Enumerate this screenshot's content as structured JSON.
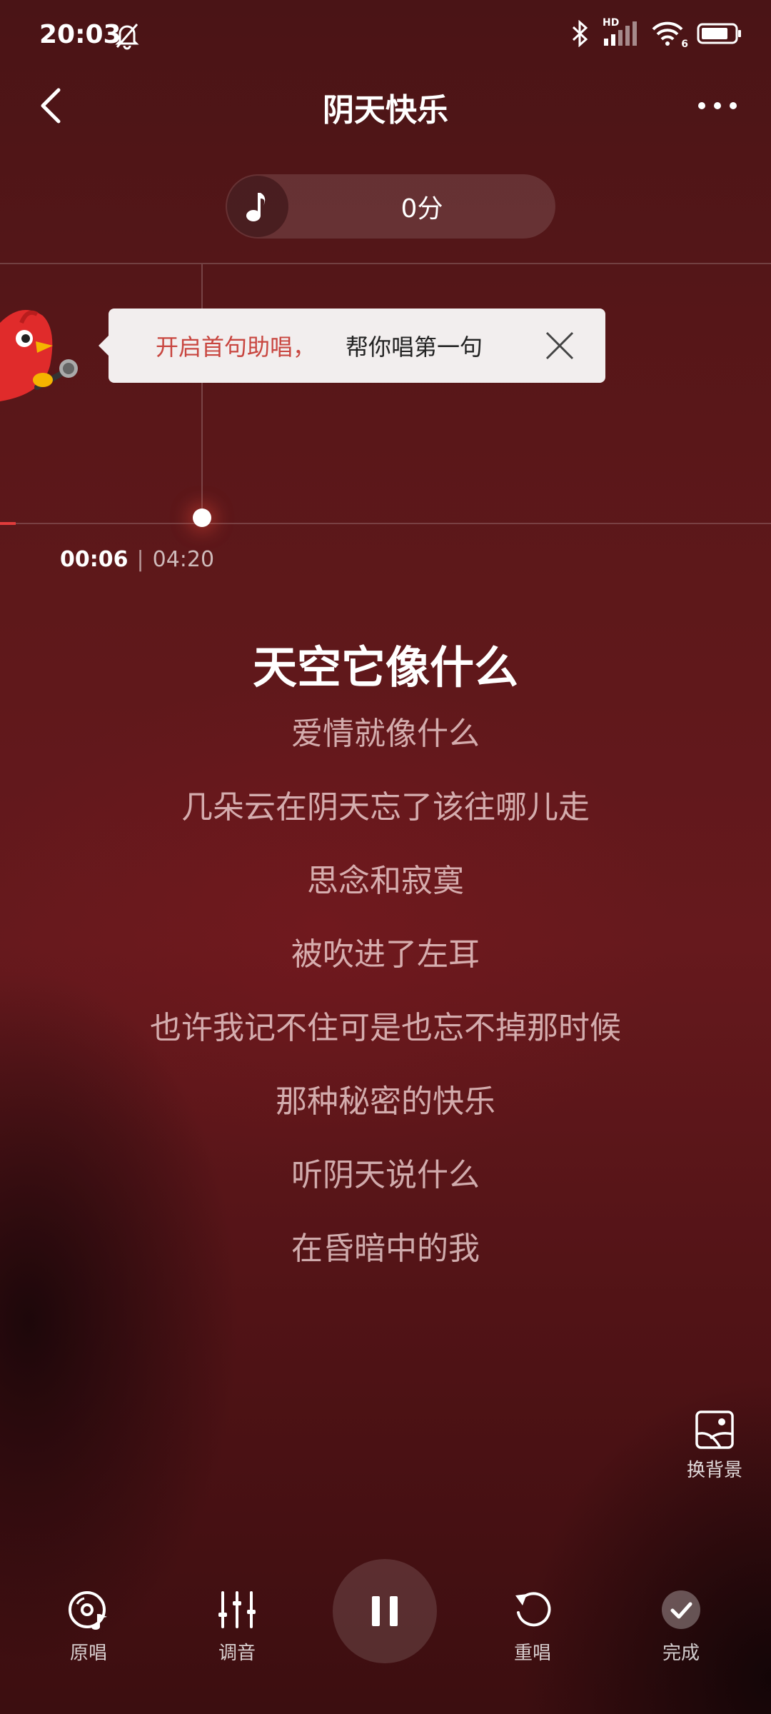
{
  "status_bar": {
    "time": "20:03",
    "network_label": "HD",
    "wifi_label": "6"
  },
  "header": {
    "title": "阴天快乐"
  },
  "score": {
    "text": "0分"
  },
  "tooltip": {
    "highlight_text": "开启首句助唱，",
    "text": "帮你唱第一句"
  },
  "playback": {
    "current_time": "00:06",
    "separator": "|",
    "total_time": "04:20",
    "progress": 0.023
  },
  "lyrics": {
    "current": "天空它像什么",
    "upcoming": [
      "爱情就像什么",
      "几朵云在阴天忘了该往哪儿走",
      "思念和寂寞",
      "被吹进了左耳",
      "也许我记不住可是也忘不掉那时候",
      "那种秘密的快乐",
      "听阴天说什么",
      "在昏暗中的我"
    ]
  },
  "background_button": {
    "label": "换背景",
    "icon": "change-background-icon"
  },
  "controls": {
    "original": {
      "label": "原唱",
      "icon": "original-vocal-icon"
    },
    "tune": {
      "label": "调音",
      "icon": "equalizer-icon"
    },
    "play": {
      "icon": "pause-icon"
    },
    "restart": {
      "label": "重唱",
      "icon": "restart-icon"
    },
    "done": {
      "label": "完成",
      "icon": "check-icon"
    }
  },
  "colors": {
    "accent_red": "#c8453f",
    "progress_red": "#e23c3c",
    "background": "#5a1719"
  }
}
